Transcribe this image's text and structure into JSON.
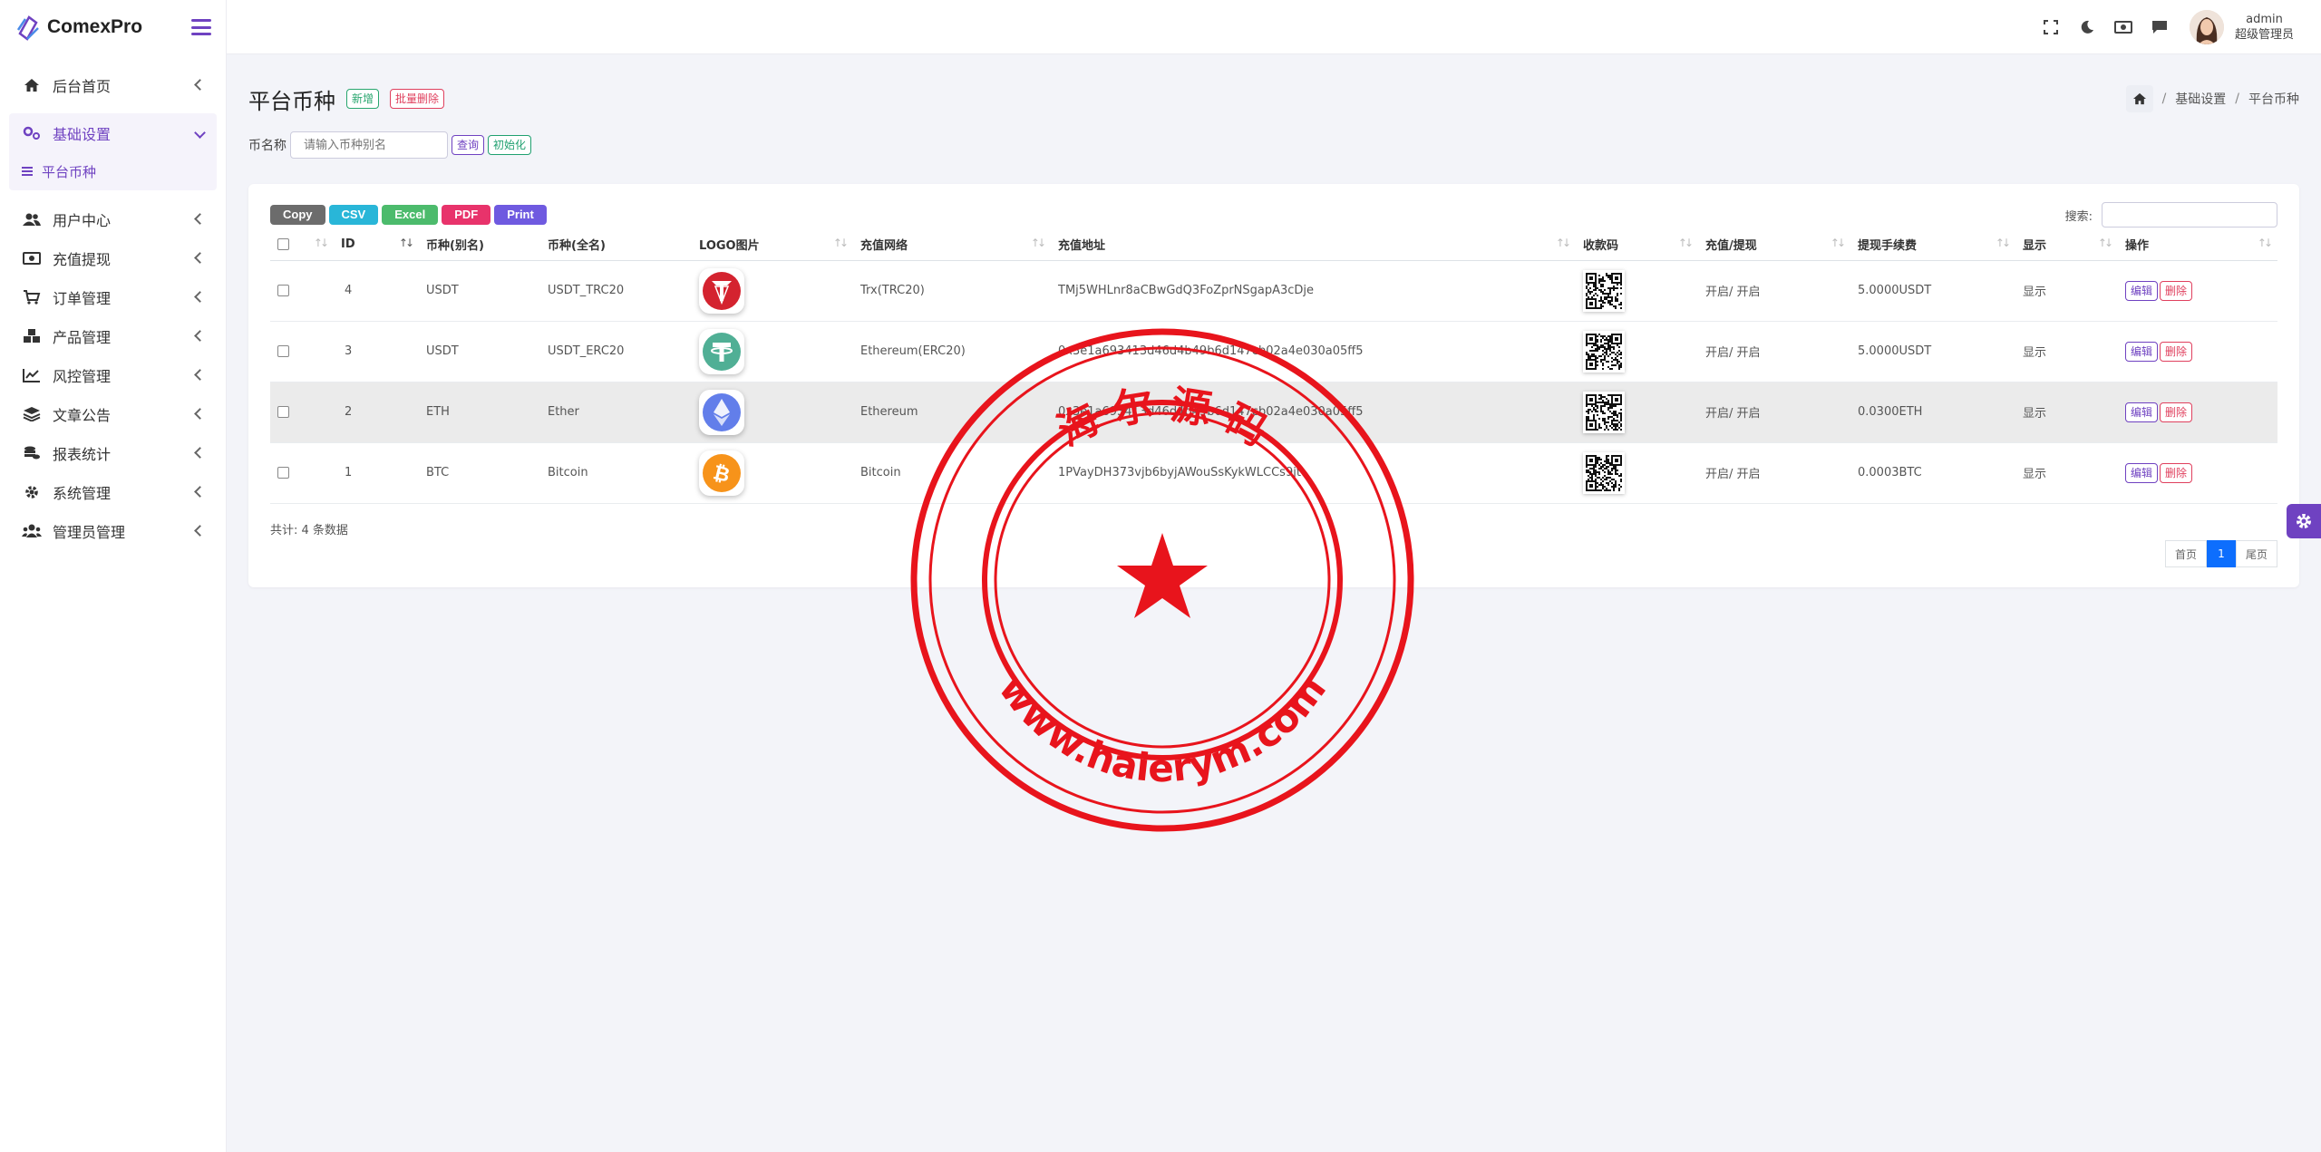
{
  "app": {
    "name": "ComexPro"
  },
  "sidebar": {
    "items": [
      {
        "label": "后台首页",
        "icon": "home-icon"
      },
      {
        "label": "基础设置",
        "icon": "cogs-icon",
        "open": true
      },
      {
        "label": "用户中心",
        "icon": "users-icon"
      },
      {
        "label": "充值提现",
        "icon": "money-icon"
      },
      {
        "label": "订单管理",
        "icon": "cart-icon"
      },
      {
        "label": "产品管理",
        "icon": "cubes-icon"
      },
      {
        "label": "风控管理",
        "icon": "chart-line-icon"
      },
      {
        "label": "文章公告",
        "icon": "layers-icon"
      },
      {
        "label": "报表统计",
        "icon": "coins-icon"
      },
      {
        "label": "系统管理",
        "icon": "gear-icon"
      },
      {
        "label": "管理员管理",
        "icon": "user-group-icon"
      }
    ],
    "sub_item": "平台币种"
  },
  "topbar": {
    "user_name": "admin",
    "user_role": "超级管理员"
  },
  "page": {
    "title": "平台币种",
    "add_label": "新增",
    "batch_delete_label": "批量删除",
    "breadcrumb": [
      "基础设置",
      "平台币种"
    ]
  },
  "filter": {
    "label": "币名称",
    "placeholder": "请输入币种别名",
    "query_label": "查询",
    "init_label": "初始化"
  },
  "toolbar": {
    "buttons": [
      {
        "label": "Copy",
        "color": "#6c6c6c"
      },
      {
        "label": "CSV",
        "color": "#29b6d8"
      },
      {
        "label": "Excel",
        "color": "#4cbb6c"
      },
      {
        "label": "PDF",
        "color": "#e8336b"
      },
      {
        "label": "Print",
        "color": "#6f5ae0"
      }
    ],
    "search_label": "搜索:"
  },
  "table": {
    "headers": [
      "ID",
      "币种(别名)",
      "币种(全名)",
      "LOGO图片",
      "充值网络",
      "充值地址",
      "收款码",
      "充值/提现",
      "提现手续费",
      "显示",
      "操作"
    ],
    "rows": [
      {
        "id": "4",
        "alias": "USDT",
        "fullname": "USDT_TRC20",
        "logo": "tron-logo",
        "network": "Trx(TRC20)",
        "address": "TMj5WHLnr8aCBwGdQ3FoZprNSgapA3cDje",
        "status": "开启/ 开启",
        "fee": "5.0000USDT",
        "display": "显示",
        "edit": "编辑",
        "delete": "删除"
      },
      {
        "id": "3",
        "alias": "USDT",
        "fullname": "USDT_ERC20",
        "logo": "tether-logo",
        "network": "Ethereum(ERC20)",
        "address": "0x3e1a693413d46d4b49b6d147cb02a4e030a05ff5",
        "status": "开启/ 开启",
        "fee": "5.0000USDT",
        "display": "显示",
        "edit": "编辑",
        "delete": "删除"
      },
      {
        "id": "2",
        "alias": "ETH",
        "fullname": "Ether",
        "logo": "ethereum-logo",
        "network": "Ethereum",
        "address": "0x3e1a693413d46d4b49b6d147cb02a4e030a05ff5",
        "status": "开启/ 开启",
        "fee": "0.0300ETH",
        "display": "显示",
        "edit": "编辑",
        "delete": "删除"
      },
      {
        "id": "1",
        "alias": "BTC",
        "fullname": "Bitcoin",
        "logo": "bitcoin-logo",
        "network": "Bitcoin",
        "address": "1PVayDH373vjb6byjAWouSsKykWLCCs9jt",
        "status": "开启/ 开启",
        "fee": "0.0003BTC",
        "display": "显示",
        "edit": "编辑",
        "delete": "删除"
      }
    ],
    "total": "共计: 4 条数据"
  },
  "pagination": {
    "first": "首页",
    "current": "1",
    "last": "尾页"
  },
  "watermark": {
    "top_text": "海 尔 源 码",
    "bottom_text": "www.haierym.com",
    "color": "#e8141c"
  },
  "colors": {
    "accent": "#6f42c1",
    "primary": "#0d6efd"
  }
}
